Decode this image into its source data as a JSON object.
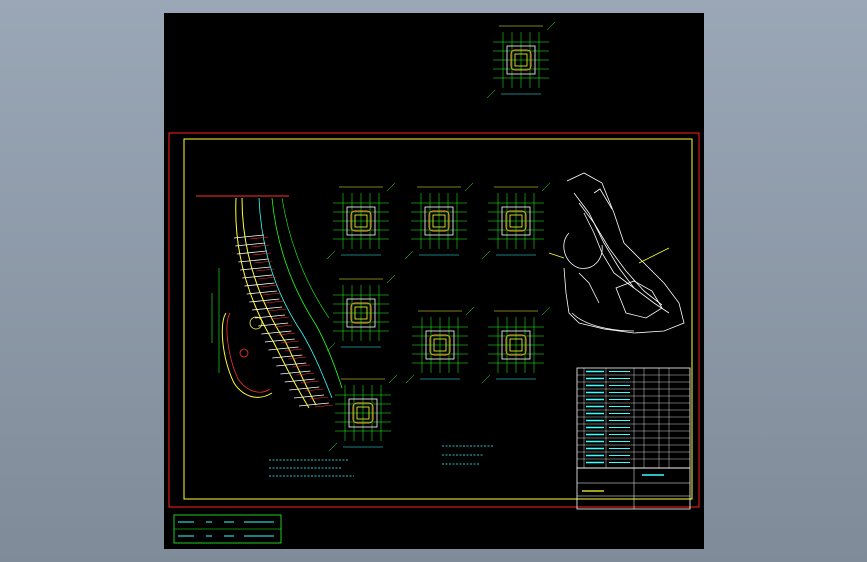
{
  "viewport": {
    "background": "#000000"
  },
  "colors": {
    "background": "#9aa7b6",
    "frame_outer": "#ff2020",
    "frame_inner": "#ffff33",
    "green": "#22ff22",
    "yellow": "#ffff33",
    "cyan": "#33ffff",
    "white": "#ffffff",
    "red": "#ff3030"
  },
  "icons": {
    "pile_detail": "column-section-icon",
    "plan": "tunnel-plan-icon",
    "elevation": "structure-elevation-icon"
  },
  "title_block": {
    "rows": 14
  },
  "legend_box": {
    "rows": 2
  }
}
